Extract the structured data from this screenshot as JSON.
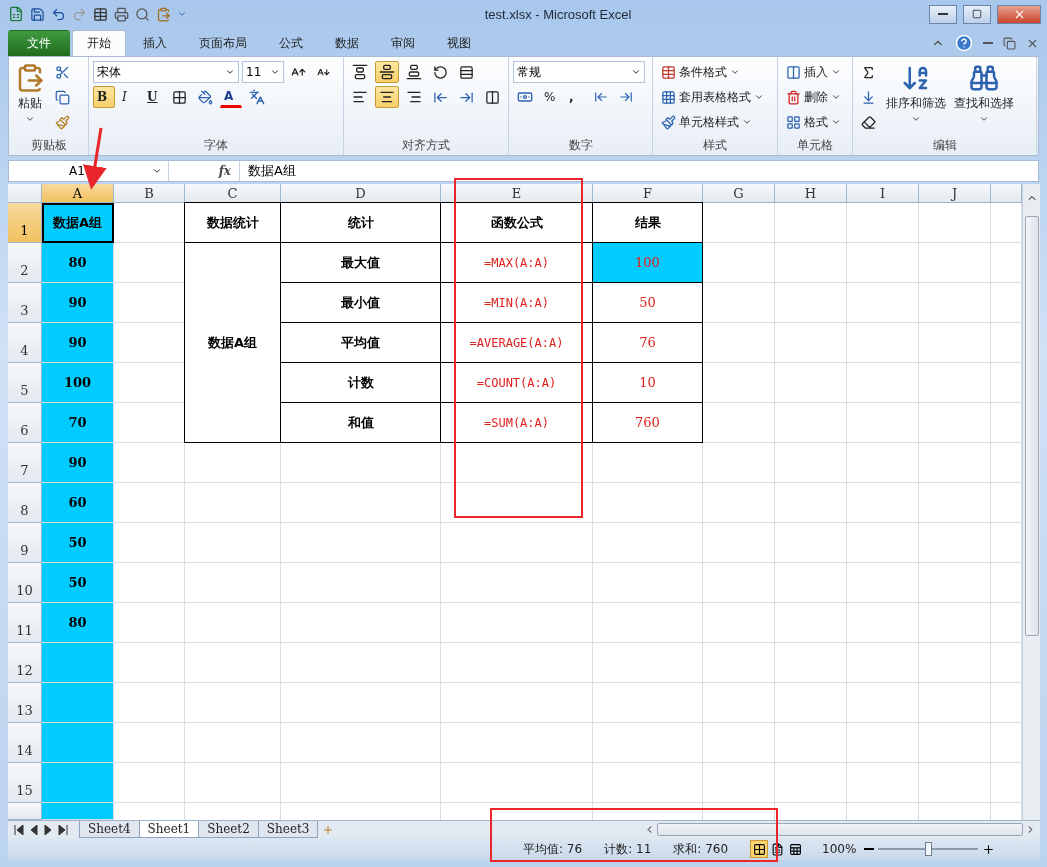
{
  "window": {
    "title": "test.xlsx - Microsoft Excel"
  },
  "tabs": [
    {
      "label": "文件",
      "kind": "file",
      "selected": false
    },
    {
      "label": "开始",
      "kind": "tab",
      "selected": true
    },
    {
      "label": "插入",
      "kind": "tab",
      "selected": false
    },
    {
      "label": "页面布局",
      "kind": "tab",
      "selected": false
    },
    {
      "label": "公式",
      "kind": "tab",
      "selected": false
    },
    {
      "label": "数据",
      "kind": "tab",
      "selected": false
    },
    {
      "label": "审阅",
      "kind": "tab",
      "selected": false
    },
    {
      "label": "视图",
      "kind": "tab",
      "selected": false
    }
  ],
  "ribbon": {
    "clipboard": {
      "label": "剪贴板",
      "paste": "粘贴"
    },
    "font": {
      "label": "字体",
      "font_name": "宋体",
      "font_size": "11",
      "bold": {
        "text": "B",
        "selected": true
      },
      "italic": {
        "text": "I",
        "selected": false
      },
      "underline": {
        "text": "U",
        "selected": false
      },
      "font_color": "A"
    },
    "alignment": {
      "label": "对齐方式",
      "vertical_align": [
        {
          "kind": "top",
          "selected": false
        },
        {
          "kind": "middle",
          "selected": true
        },
        {
          "kind": "bottom",
          "selected": false
        }
      ],
      "horizontal_align": [
        {
          "kind": "left",
          "selected": false
        },
        {
          "kind": "center",
          "selected": true
        },
        {
          "kind": "right",
          "selected": false
        }
      ]
    },
    "number": {
      "label": "数字",
      "format": "常规",
      "percent": "%",
      "comma": ","
    },
    "styles": {
      "label": "样式",
      "items": [
        {
          "kind": "conditional",
          "label": "条件格式"
        },
        {
          "kind": "table",
          "label": "套用表格格式"
        },
        {
          "kind": "cell",
          "label": "单元格样式"
        }
      ]
    },
    "cells": {
      "label": "单元格",
      "items": [
        {
          "kind": "insert",
          "label": "插入"
        },
        {
          "kind": "delete",
          "label": "删除"
        },
        {
          "kind": "format",
          "label": "格式"
        }
      ]
    },
    "editing": {
      "label": "编辑",
      "sort": "排序和筛选",
      "find": "查找和选择"
    }
  },
  "formula_bar": {
    "name_box": "A1",
    "fx": "fx",
    "content": "数据A组"
  },
  "sheet": {
    "columns": [
      {
        "label": "A",
        "selected": true
      },
      {
        "label": "B",
        "selected": false
      },
      {
        "label": "C",
        "selected": false
      },
      {
        "label": "D",
        "selected": false
      },
      {
        "label": "E",
        "selected": false
      },
      {
        "label": "F",
        "selected": false
      },
      {
        "label": "G",
        "selected": false
      },
      {
        "label": "H",
        "selected": false
      },
      {
        "label": "I",
        "selected": false
      },
      {
        "label": "J",
        "selected": false
      }
    ],
    "rows": [
      {
        "label": "1",
        "selected": true,
        "cells": [
          {
            "text": "数据A组",
            "kind": "heading",
            "highlighted": true,
            "bordered": false,
            "selected": true
          },
          null,
          {
            "text": "数据统计",
            "kind": "heading",
            "highlighted": false,
            "bordered": true,
            "selected": false
          },
          {
            "text": "统计",
            "kind": "heading",
            "highlighted": false,
            "bordered": true,
            "selected": false
          },
          {
            "text": "函数公式",
            "kind": "heading",
            "highlighted": false,
            "bordered": true,
            "selected": false
          },
          {
            "text": "结果",
            "kind": "heading",
            "highlighted": false,
            "bordered": true,
            "selected": false
          }
        ]
      },
      {
        "label": "2",
        "selected": false,
        "cells": [
          {
            "text": "80",
            "kind": "data",
            "highlighted": true,
            "bordered": false,
            "selected": false
          },
          null,
          {
            "kind": "covered"
          },
          {
            "text": "最大值",
            "kind": "heading",
            "highlighted": false,
            "bordered": true,
            "selected": false
          },
          {
            "text": "=MAX(A:A)",
            "kind": "formula",
            "highlighted": false,
            "bordered": true,
            "selected": false
          },
          {
            "text": "100",
            "kind": "result",
            "highlighted": true,
            "bordered": true,
            "selected": false
          }
        ]
      },
      {
        "label": "3",
        "selected": false,
        "cells": [
          {
            "text": "90",
            "kind": "data",
            "highlighted": true,
            "bordered": false,
            "selected": false
          },
          null,
          {
            "kind": "covered"
          },
          {
            "text": "最小值",
            "kind": "heading",
            "highlighted": false,
            "bordered": true,
            "selected": false
          },
          {
            "text": "=MIN(A:A)",
            "kind": "formula",
            "highlighted": false,
            "bordered": true,
            "selected": false
          },
          {
            "text": "50",
            "kind": "result",
            "highlighted": false,
            "bordered": true,
            "selected": false
          }
        ]
      },
      {
        "label": "4",
        "selected": false,
        "cells": [
          {
            "text": "90",
            "kind": "data",
            "highlighted": true,
            "bordered": false,
            "selected": false
          },
          null,
          {
            "text": "数据A组",
            "kind": "heading",
            "merged": true,
            "highlighted": false,
            "bordered": true,
            "selected": false
          },
          {
            "text": "平均值",
            "kind": "heading",
            "highlighted": false,
            "bordered": true,
            "selected": false
          },
          {
            "text": "=AVERAGE(A:A)",
            "kind": "formula",
            "highlighted": false,
            "bordered": true,
            "selected": false
          },
          {
            "text": "76",
            "kind": "result",
            "highlighted": false,
            "bordered": true,
            "selected": false
          }
        ]
      },
      {
        "label": "5",
        "selected": false,
        "cells": [
          {
            "text": "100",
            "kind": "data",
            "highlighted": true,
            "bordered": false,
            "selected": false
          },
          null,
          {
            "kind": "covered"
          },
          {
            "text": "计数",
            "kind": "heading",
            "highlighted": false,
            "bordered": true,
            "selected": false
          },
          {
            "text": "=COUNT(A:A)",
            "kind": "formula",
            "highlighted": false,
            "bordered": true,
            "selected": false
          },
          {
            "text": "10",
            "kind": "result",
            "highlighted": false,
            "bordered": true,
            "selected": false
          }
        ]
      },
      {
        "label": "6",
        "selected": false,
        "cells": [
          {
            "text": "70",
            "kind": "data",
            "highlighted": true,
            "bordered": false,
            "selected": false
          },
          null,
          {
            "kind": "covered"
          },
          {
            "text": "和值",
            "kind": "heading",
            "highlighted": false,
            "bordered": true,
            "selected": false
          },
          {
            "text": "=SUM(A:A)",
            "kind": "formula",
            "highlighted": false,
            "bordered": true,
            "selected": false
          },
          {
            "text": "760",
            "kind": "result",
            "highlighted": false,
            "bordered": true,
            "selected": false
          }
        ]
      },
      {
        "label": "7",
        "selected": false,
        "cells": [
          {
            "text": "90",
            "kind": "data",
            "highlighted": true,
            "bordered": false,
            "selected": false
          }
        ]
      },
      {
        "label": "8",
        "selected": false,
        "cells": [
          {
            "text": "60",
            "kind": "data",
            "highlighted": true,
            "bordered": false,
            "selected": false
          }
        ]
      },
      {
        "label": "9",
        "selected": false,
        "cells": [
          {
            "text": "50",
            "kind": "data",
            "highlighted": true,
            "bordered": false,
            "selected": false
          }
        ]
      },
      {
        "label": "10",
        "selected": false,
        "cells": [
          {
            "text": "50",
            "kind": "data",
            "highlighted": true,
            "bordered": false,
            "selected": false
          }
        ]
      },
      {
        "label": "11",
        "selected": false,
        "cells": [
          {
            "text": "80",
            "kind": "data",
            "highlighted": true,
            "bordered": false,
            "selected": false
          }
        ]
      },
      {
        "label": "12",
        "selected": false,
        "cells": [
          {
            "kind": "data",
            "highlighted": true,
            "bordered": false,
            "selected": false
          }
        ]
      },
      {
        "label": "13",
        "selected": false,
        "cells": [
          {
            "kind": "data",
            "highlighted": true,
            "bordered": false,
            "selected": false
          }
        ]
      },
      {
        "label": "14",
        "selected": false,
        "cells": [
          {
            "kind": "data",
            "highlighted": true,
            "bordered": false,
            "selected": false
          }
        ]
      },
      {
        "label": "15",
        "selected": false,
        "cells": [
          {
            "kind": "data",
            "highlighted": true,
            "bordered": false,
            "selected": false
          }
        ]
      },
      {
        "selected": false,
        "cells": [
          {
            "kind": "data",
            "highlighted": true,
            "bordered": false,
            "selected": false
          }
        ]
      }
    ]
  },
  "sheet_tabs": [
    {
      "label": "Sheet4",
      "selected": false
    },
    {
      "label": "Sheet1",
      "selected": true
    },
    {
      "label": "Sheet2",
      "selected": false
    },
    {
      "label": "Sheet3",
      "selected": false
    }
  ],
  "status_bar": {
    "items": [
      "平均值: 76",
      "计数: 11",
      "求和: 760"
    ],
    "views": [
      {
        "kind": "normal",
        "selected": true
      },
      {
        "kind": "layout",
        "selected": false
      },
      {
        "kind": "break",
        "selected": false
      }
    ],
    "zoom": "100%",
    "zoom_slider": {
      "level": 0.5
    }
  }
}
